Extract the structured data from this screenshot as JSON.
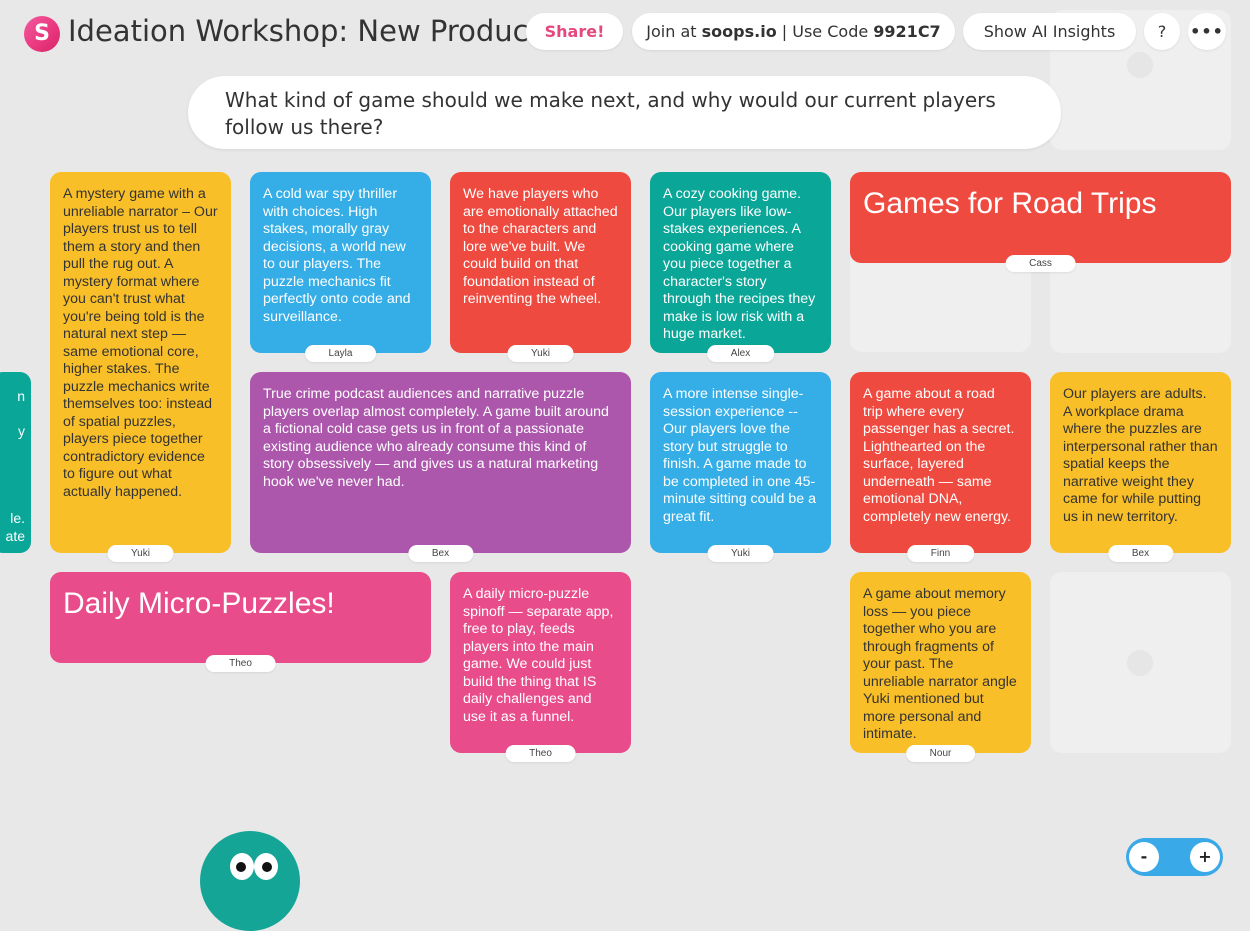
{
  "header": {
    "logo_letter": "S",
    "title": "Ideation Workshop: New Product",
    "share_label": "Share!",
    "join_prefix": "Join at ",
    "join_site": "soops.io",
    "join_mid": " | Use Code ",
    "join_code": "9921C7",
    "insights_label": "Show AI Insights",
    "help_label": "?",
    "more_label": "•••"
  },
  "prompt": {
    "question": "What kind of game should we make next, and why would our current players follow us there?"
  },
  "partial_card": {
    "visible_top": "n\n\ny",
    "visible_bottom": "le.\nate"
  },
  "cards": [
    {
      "text": "A mystery game with a unreliable narrator – Our players trust us to tell them a story and then pull the rug out. A mystery format where you can't trust what you're being told is the natural next step — same emotional core, higher stakes. The puzzle mechanics write themselves too: instead of spatial puzzles, players piece together contradictory evidence to figure out what actually happened.",
      "author": "Yuki",
      "color": "yellow"
    },
    {
      "text": "A cold war spy thriller with choices. High stakes, morally gray decisions, a world new to our players. The puzzle mechanics fit perfectly onto code and surveillance.",
      "author": "Layla",
      "color": "blue"
    },
    {
      "text": "We have players who are emotionally attached to the characters and lore we've built. We could build on that foundation instead of reinventing the wheel.",
      "author": "Yuki",
      "color": "red"
    },
    {
      "text": "A cozy cooking game. Our players like low-stakes experiences. A cooking game where you piece together a character's story through the recipes they make is low risk with a huge market.",
      "author": "Alex",
      "color": "teal"
    },
    {
      "text": "Games for Road Trips",
      "author": "Cass",
      "color": "red"
    },
    {
      "text": "True crime podcast audiences and narrative puzzle players overlap almost completely. A game built around a fictional cold case gets us in front of a passionate existing audience who already consume this kind of story obsessively — and gives us a natural marketing hook we've never had.",
      "author": "Bex",
      "color": "purple"
    },
    {
      "text": "A more intense single-session experience -- Our  players love the story but struggle to finish. A game made to be completed in one 45-minute sitting could be a great fit.",
      "author": "Yuki",
      "color": "blue"
    },
    {
      "text": "A game about a road trip where every passenger has a secret. Lighthearted on the surface, layered underneath — same emotional DNA, completely new energy.",
      "author": "Finn",
      "color": "red"
    },
    {
      "text": "Our players are adults. A workplace drama where the puzzles are interpersonal rather than spatial keeps the narrative weight they came for while putting us in new territory.",
      "author": "Bex",
      "color": "yellow"
    },
    {
      "text": "Daily Micro-Puzzles!",
      "author": "Theo",
      "color": "pink"
    },
    {
      "text": "A daily micro-puzzle spinoff — separate app, free to play, feeds players into the main game. We could just build the thing that IS daily challenges and use it as a funnel.",
      "author": "Theo",
      "color": "pink"
    },
    {
      "text": "A game about memory loss — you piece together who you are through fragments of your past. The unreliable narrator angle Yuki mentioned but more personal and intimate.",
      "author": "Nour",
      "color": "yellow"
    }
  ],
  "zoom": {
    "minus_label": "-",
    "plus_label": "+"
  },
  "colors": {
    "yellow": "#f9bf28",
    "blue": "#35ade6",
    "red": "#ef4a3f",
    "teal": "#0aa697",
    "purple": "#ac57ac",
    "pink": "#e84c8a",
    "share_text": "#e5487f",
    "zoom": "#3aa9e8"
  },
  "icons": {
    "mascot": "googly-eyed-teal-blob-icon",
    "logo": "soops-logo-icon"
  }
}
